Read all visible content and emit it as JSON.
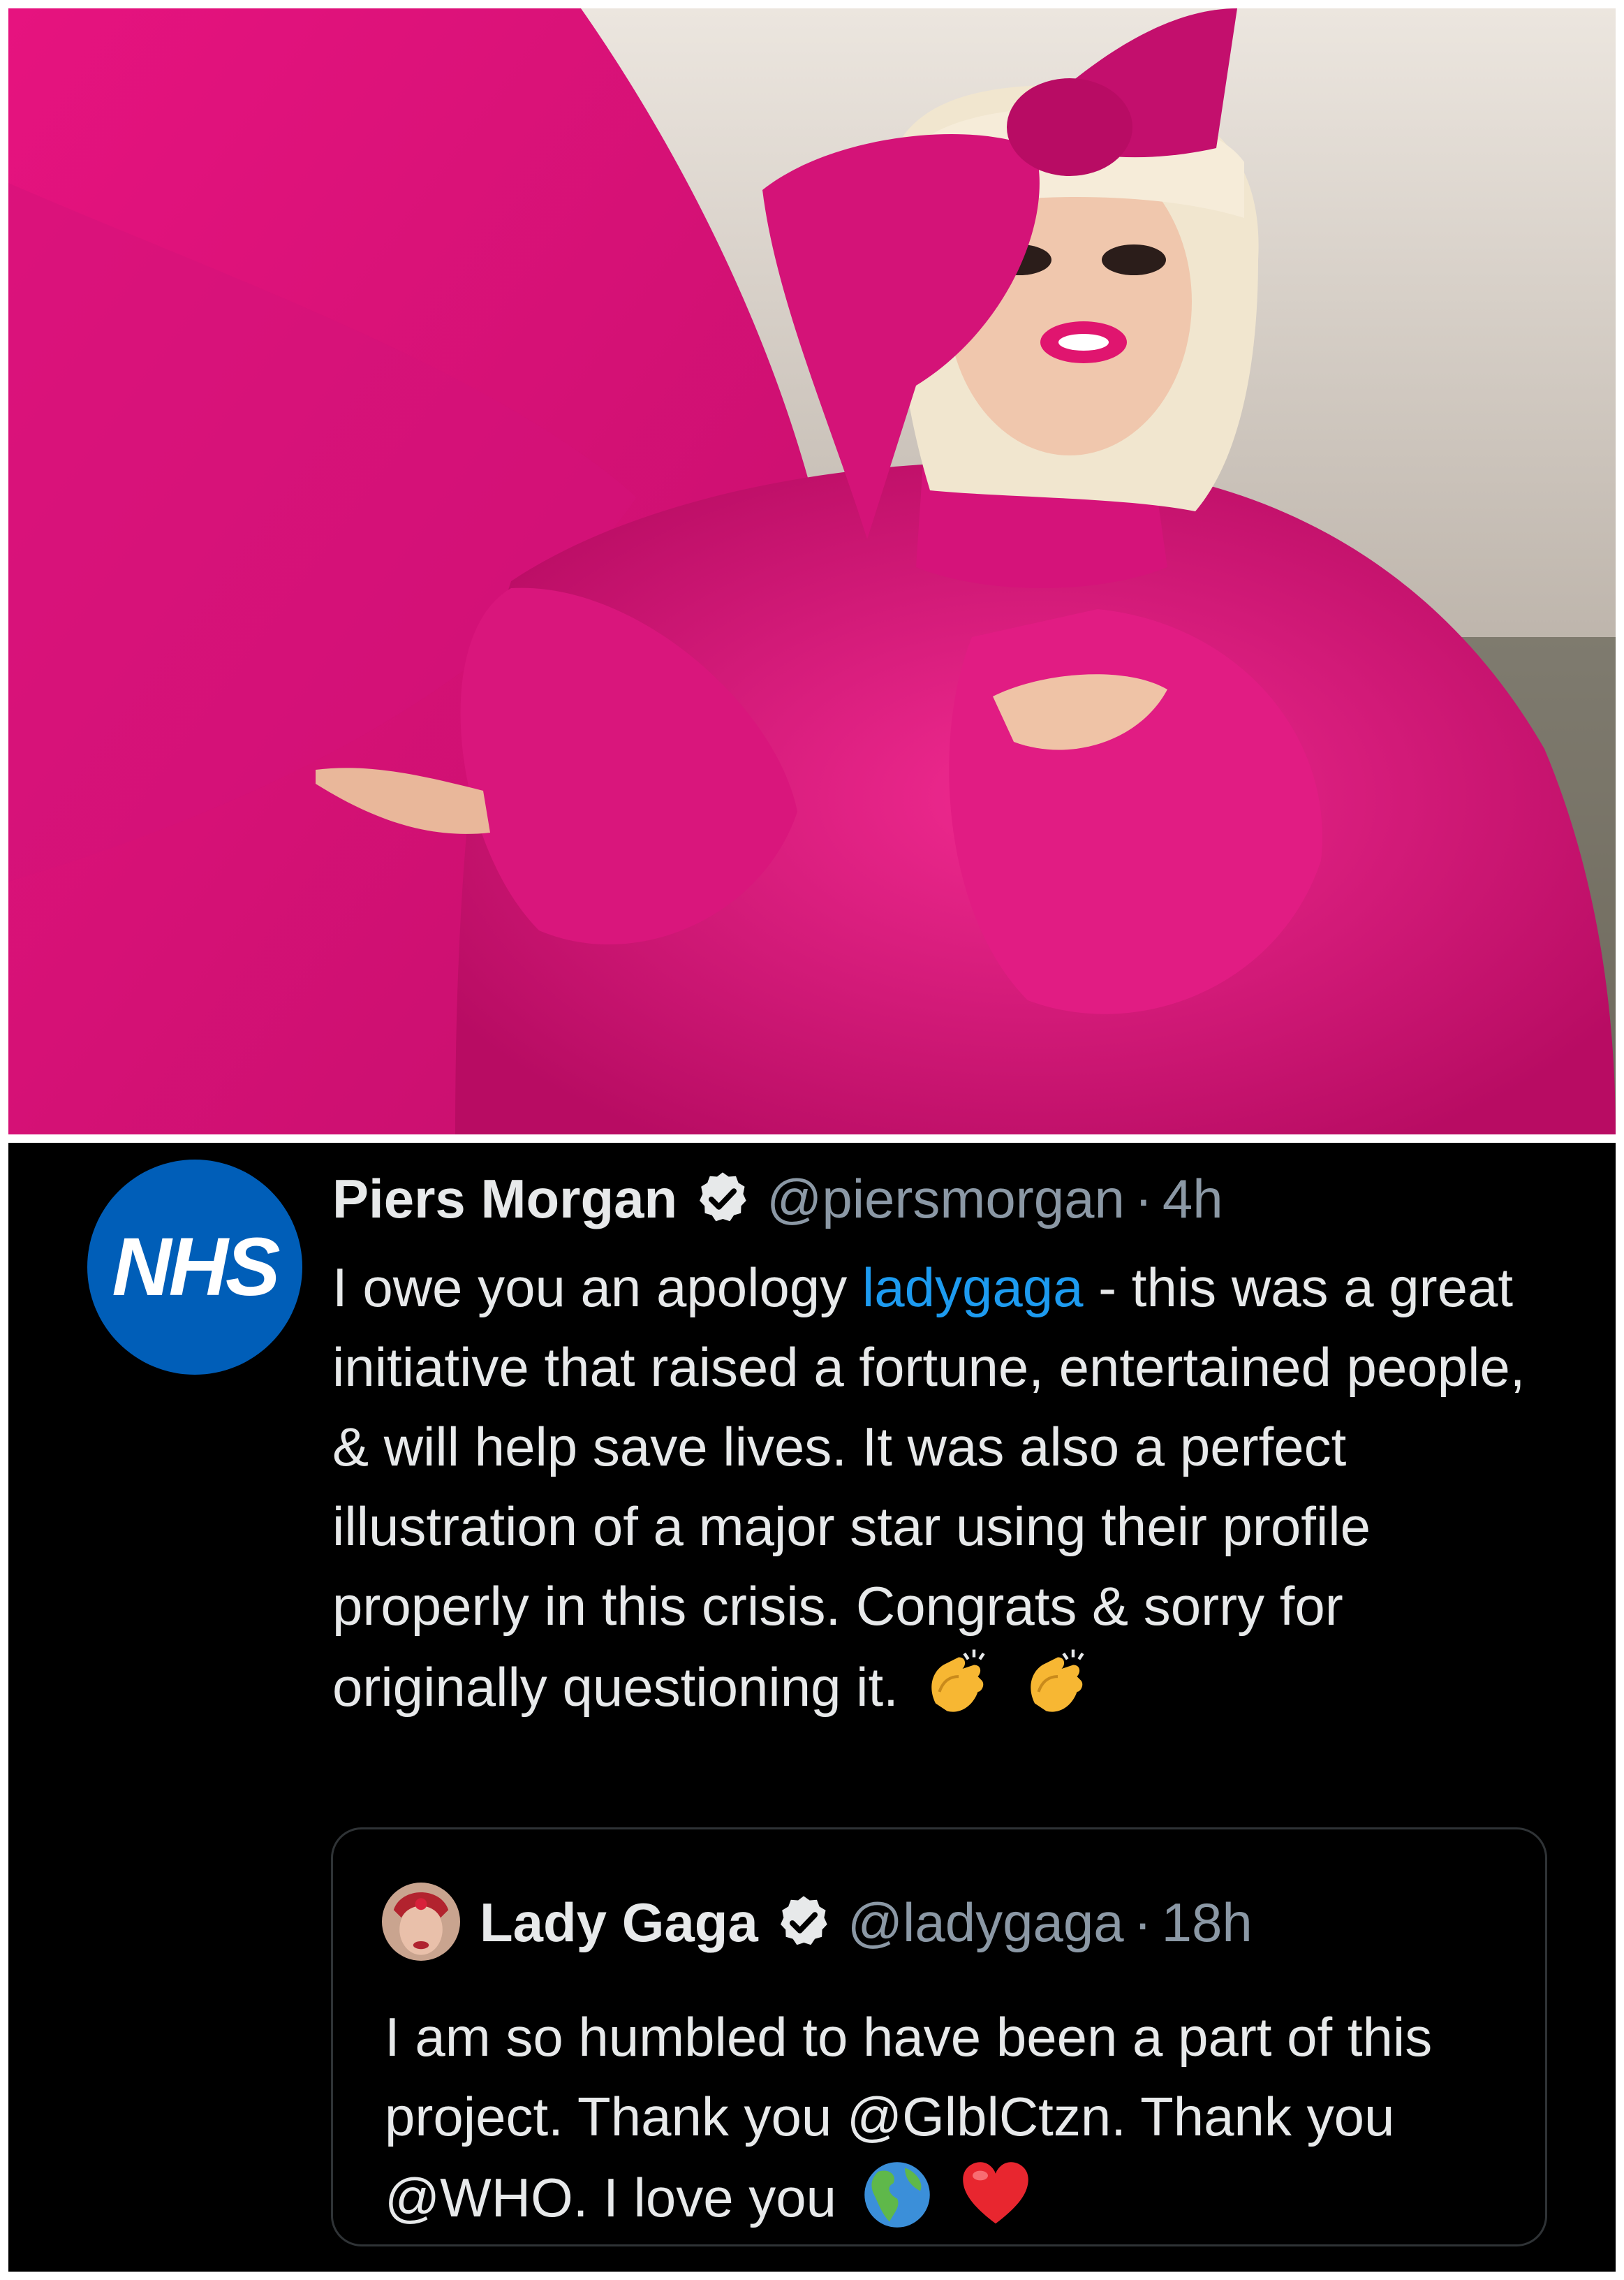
{
  "tweet": {
    "avatar_text": "NHS",
    "name": "Piers Morgan",
    "handle": "@piersmorgan",
    "separator": "·",
    "time": "4h",
    "text_before_mention": "I owe you an apology ",
    "mention": "ladygaga",
    "text_after_mention": " - this was a great initiative that raised a fortune, entertained people, & will help save lives. It was also a perfect illustration of a major star using their profile properly in this crisis. Congrats & sorry for originally questioning it.",
    "emojis": [
      "clapping-hands",
      "clapping-hands"
    ]
  },
  "quoted_tweet": {
    "name": "Lady Gaga",
    "handle": "@ladygaga",
    "separator": "·",
    "time": "18h",
    "text": "I am so humbled to have been a part of this project. Thank you @GlblCtzn. Thank you @WHO. I love you",
    "emojis": [
      "globe-americas",
      "red-heart"
    ]
  },
  "colors": {
    "background": "#000000",
    "primary_text": "#e7e9ea",
    "secondary_text": "#8b98a5",
    "link": "#1d9bf0",
    "nhs_blue": "#005eb8",
    "dress_pink": "#e0157e"
  }
}
